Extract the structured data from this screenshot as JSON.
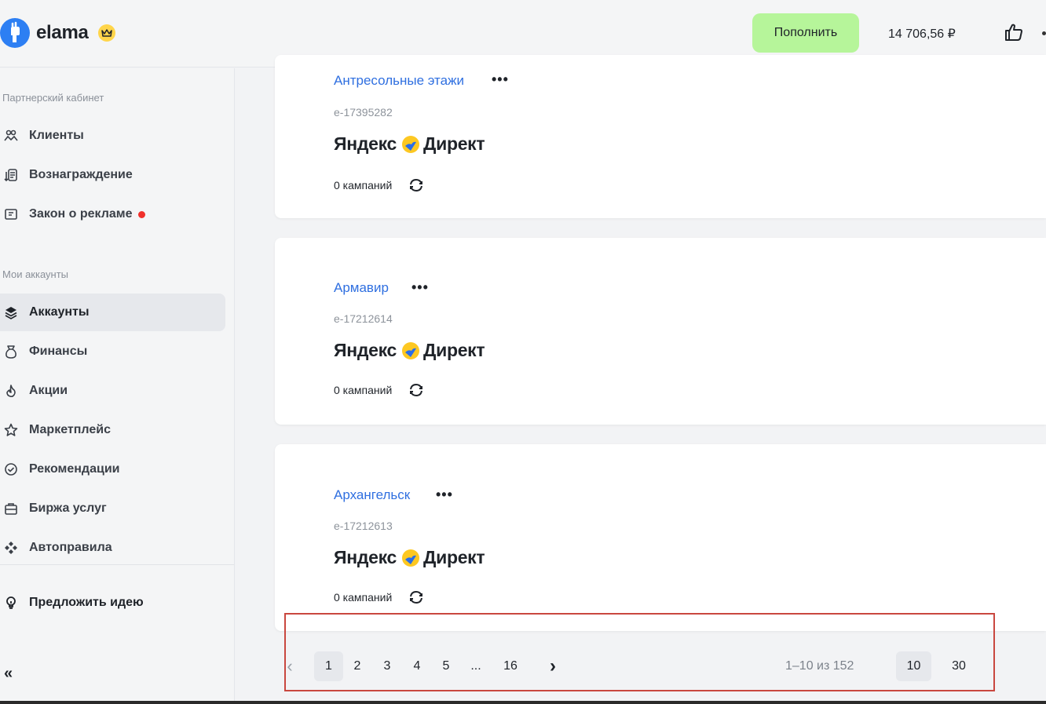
{
  "header": {
    "logo_text": "elama",
    "topup_label": "Пополнить",
    "balance": "14 706,56 ₽"
  },
  "sidebar": {
    "partner_section": "Партнерский кабинет",
    "partner_items": [
      {
        "label": "Клиенты",
        "icon": "users-icon"
      },
      {
        "label": "Вознаграждение",
        "icon": "reward-icon"
      },
      {
        "label": "Закон о рекламе",
        "icon": "law-icon",
        "badge": "red-dot"
      }
    ],
    "accounts_section": "Мои аккаунты",
    "account_items": [
      {
        "label": "Аккаунты",
        "icon": "layers-icon",
        "active": true
      },
      {
        "label": "Финансы",
        "icon": "money-bag-icon"
      },
      {
        "label": "Акции",
        "icon": "fire-icon"
      },
      {
        "label": "Маркетплейс",
        "icon": "star-icon"
      },
      {
        "label": "Рекомендации",
        "icon": "check-circle-icon"
      },
      {
        "label": "Биржа услуг",
        "icon": "briefcase-icon"
      },
      {
        "label": "Автоправила",
        "icon": "diamonds-icon"
      }
    ],
    "idea_label": "Предложить идею",
    "collapse_label": "«"
  },
  "accounts": [
    {
      "name": "Антресольные этажи",
      "id": "e-17395282",
      "platform_left": "Яндекс",
      "platform_right": "Директ",
      "campaigns": "0 кампаний"
    },
    {
      "name": "Армавир",
      "id": "e-17212614",
      "platform_left": "Яндекс",
      "platform_right": "Директ",
      "campaigns": "0 кампаний"
    },
    {
      "name": "Архангельск",
      "id": "e-17212613",
      "platform_left": "Яндекс",
      "platform_right": "Директ",
      "campaigns": "0 кампаний"
    }
  ],
  "pagination": {
    "prev": "‹",
    "pages": [
      "1",
      "2",
      "3",
      "4",
      "5",
      "...",
      "16"
    ],
    "current": "1",
    "next": "›",
    "range_info": "1–10 из 152",
    "page_sizes": [
      "10",
      "30"
    ],
    "selected_size": "10"
  },
  "colors": {
    "accent_link": "#2f6fe0",
    "topup_bg": "#b6f59a",
    "highlight_border": "#c9473f",
    "alert_dot": "#f0302b"
  }
}
